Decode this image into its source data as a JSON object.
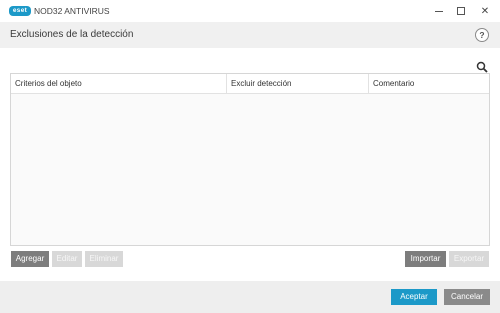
{
  "window": {
    "logo_text": "eset",
    "app_name": "NOD32 ANTIVIRUS",
    "controls": {
      "minimize_icon": "minimize-icon",
      "maximize_icon": "maximize-icon",
      "close_symbol": "✕"
    }
  },
  "header": {
    "title": "Exclusiones de la detección",
    "help_label": "?"
  },
  "table": {
    "search_icon": "search-icon",
    "columns": [
      "Criterios del objeto",
      "Excluir detección",
      "Comentario"
    ],
    "rows": []
  },
  "actions": {
    "add": "Agregar",
    "edit": "Editar",
    "delete": "Eliminar",
    "import": "Importar",
    "export": "Exportar"
  },
  "footer": {
    "accept": "Aceptar",
    "cancel": "Cancelar"
  },
  "colors": {
    "accent": "#1c99c8",
    "button_dark": "#7d7d7d",
    "button_disabled": "#d8d8d8",
    "footer_bg": "#eeeeee"
  }
}
